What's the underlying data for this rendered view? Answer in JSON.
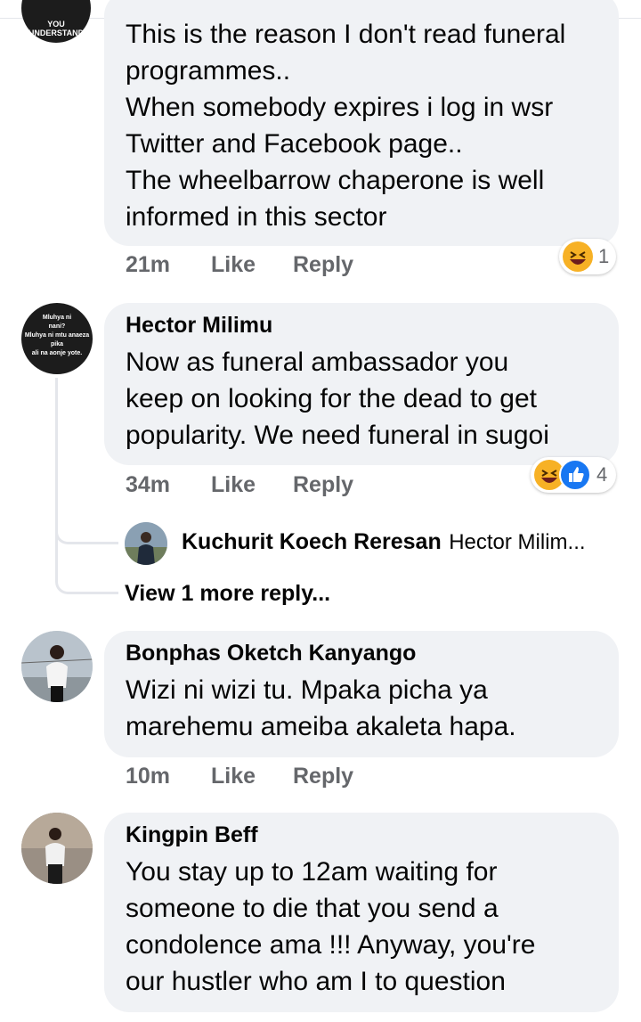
{
  "top_avatar_caption": "YOU UNDERSTAND",
  "comments": [
    {
      "text": "This is the reason I don't read funeral\nprogrammes..\nWhen somebody expires i log in wsr\nTwitter and Facebook page..\nThe wheelbarrow chaperone is well\ninformed in this sector",
      "time": "21m",
      "like": "Like",
      "reply": "Reply",
      "reaction_count": "1"
    },
    {
      "author": "Hector Milimu",
      "avatar_text": "Mluhya ni\nnani?\nMluhya ni mtu anaeza\npika\nali na aonje yote.",
      "text": "Now as funeral ambassador you\nkeep on looking for the dead to get\npopularity. We need funeral in sugoi",
      "time": "34m",
      "like": "Like",
      "reply": "Reply",
      "reaction_count": "4",
      "reply_preview": {
        "author": "Kuchurit Koech Reresan",
        "snippet": "Hector Milim..."
      },
      "view_more": "View 1 more reply..."
    },
    {
      "author": "Bonphas Oketch Kanyango",
      "text": "Wizi ni wizi tu. Mpaka picha ya\nmarehemu ameiba akaleta hapa.",
      "time": "10m",
      "like": "Like",
      "reply": "Reply"
    },
    {
      "author": "Kingpin Beff",
      "text": "You stay up to 12am waiting for\nsomeone to die that you send a\ncondolence ama !!! Anyway, you're\nour hustler who am I to question",
      "time": "",
      "like": "",
      "reply": ""
    }
  ],
  "colors": {
    "bubble": "#f0f2f5",
    "meta": "#65676b",
    "like_blue": "#1877f2",
    "haha_yellow": "#f7b125"
  }
}
